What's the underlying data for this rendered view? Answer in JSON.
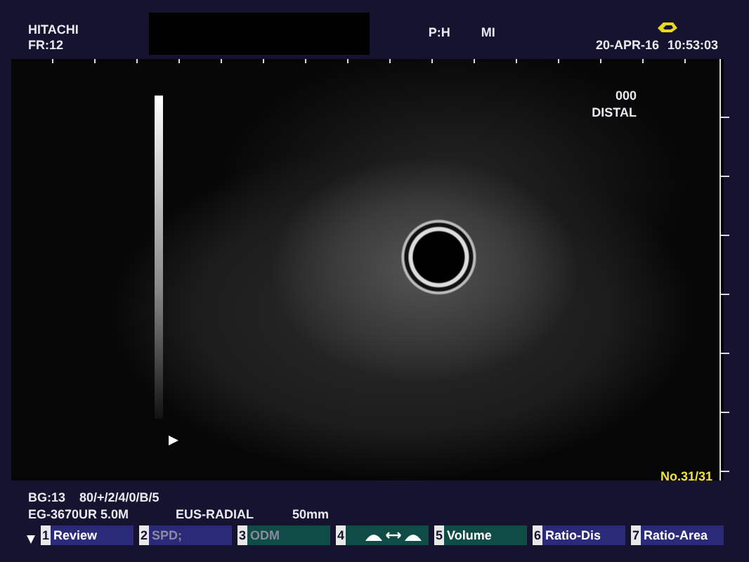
{
  "header": {
    "brand": "HITACHI",
    "frame_rate": "FR:12",
    "probe_mode": "P:H",
    "mi_label": "MI",
    "date": "20-APR-16",
    "time": "10:53:03"
  },
  "image_overlay": {
    "counter": "000",
    "position": "DISTAL",
    "image_number": "No.31/31"
  },
  "info": {
    "line_1": [
      "BG:13",
      "80/+/2/4/0/B/5"
    ],
    "line_2": [
      "EG-3670UR 5.0M",
      "EUS-RADIAL",
      "50mm"
    ]
  },
  "softkeys": [
    {
      "number": "1",
      "kind": "text",
      "label": "Review",
      "disabled": false,
      "color": "#2a2a78"
    },
    {
      "number": "2",
      "kind": "text",
      "label": "SPD;",
      "disabled": true,
      "color": "#2a2a78"
    },
    {
      "number": "3",
      "kind": "text",
      "label": "ODM",
      "disabled": true,
      "color": "#0f4c46"
    },
    {
      "number": "4",
      "kind": "icon",
      "disabled": false,
      "color": "#0f4c46"
    },
    {
      "number": "5",
      "kind": "text",
      "label": "Volume",
      "disabled": false,
      "color": "#0f4c46"
    },
    {
      "number": "6",
      "kind": "text",
      "label": "Ratio-Dis",
      "disabled": false,
      "color": "#2a2a78"
    },
    {
      "number": "7",
      "kind": "text",
      "label": "Ratio-Area",
      "disabled": false,
      "color": "#2a2a78"
    }
  ]
}
